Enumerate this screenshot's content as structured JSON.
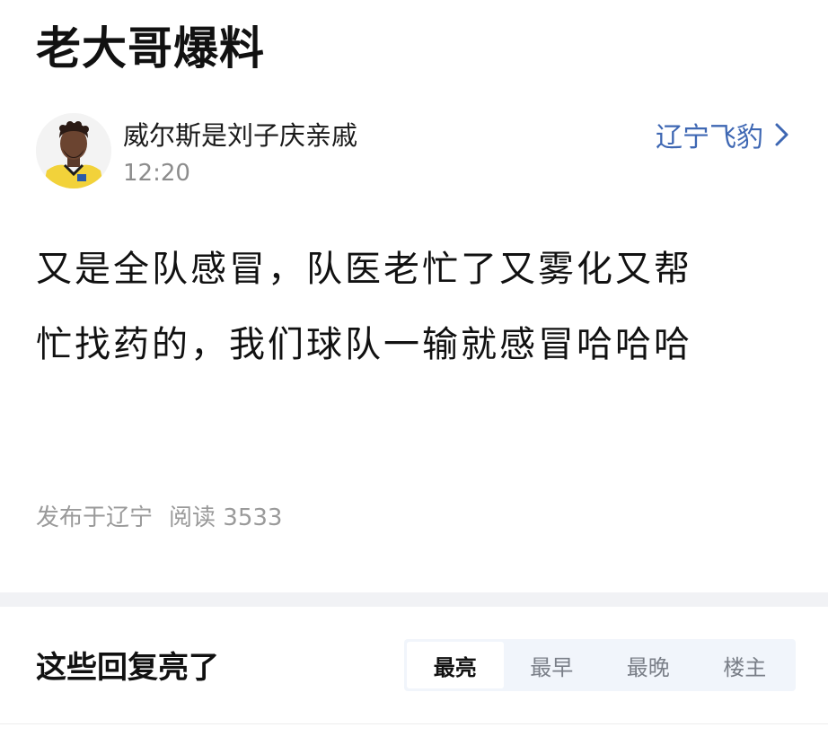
{
  "post": {
    "title": "老大哥爆料",
    "author_name": "威尔斯是刘子庆亲戚",
    "time": "12:20",
    "team_link": "辽宁飞豹",
    "body_line1": "又是全队感冒，队医老忙了又雾化又帮",
    "body_line2": "忙找药的，我们球队一输就感冒哈哈哈",
    "location": "发布于辽宁",
    "reads": "阅读 3533"
  },
  "replies": {
    "title": "这些回复亮了",
    "tabs": [
      {
        "label": "最亮"
      },
      {
        "label": "最早"
      },
      {
        "label": "最晚"
      },
      {
        "label": "楼主"
      }
    ]
  },
  "icons": {
    "avatar": "player-avatar",
    "team_chevron": "chevron-right-icon"
  },
  "colors": {
    "link": "#3e67b3",
    "meta": "#9a9a9a",
    "divider": "#f1f2f5",
    "tabs_bg": "#f1f5fb"
  }
}
